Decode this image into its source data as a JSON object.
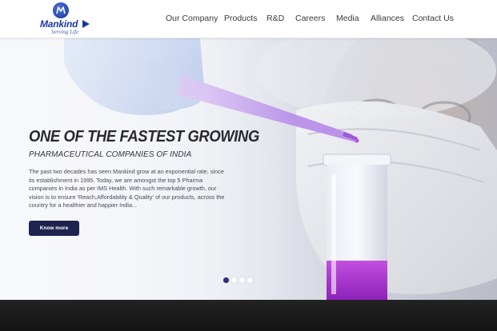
{
  "brand": {
    "name": "Mankind",
    "tagline": "Serving Life",
    "color": "#1a3a9e"
  },
  "nav": {
    "items": [
      {
        "label": "Our Company"
      },
      {
        "label": "Products"
      },
      {
        "label": "R&D"
      },
      {
        "label": "Careers"
      },
      {
        "label": "Media"
      },
      {
        "label": "Alliances"
      },
      {
        "label": "Contact Us"
      }
    ]
  },
  "hero": {
    "title": "ONE OF THE FASTEST GROWING",
    "subtitle": "PHARMACEUTICAL COMPANIES OF INDIA",
    "body": "The past two decades has seen Mankind grow at an exponential rate, since its establishment in 1995. Today, we are amongst the top 5 Pharma companies in India as per IMS Health. With such remarkable growth, our vision is to ensure 'Reach,Affordability & Quality' of our products, across the country for a healthier and happier India...",
    "button_label": "Know more",
    "button_color": "#1f2350",
    "slides": {
      "count": 4,
      "active_index": 0
    }
  }
}
